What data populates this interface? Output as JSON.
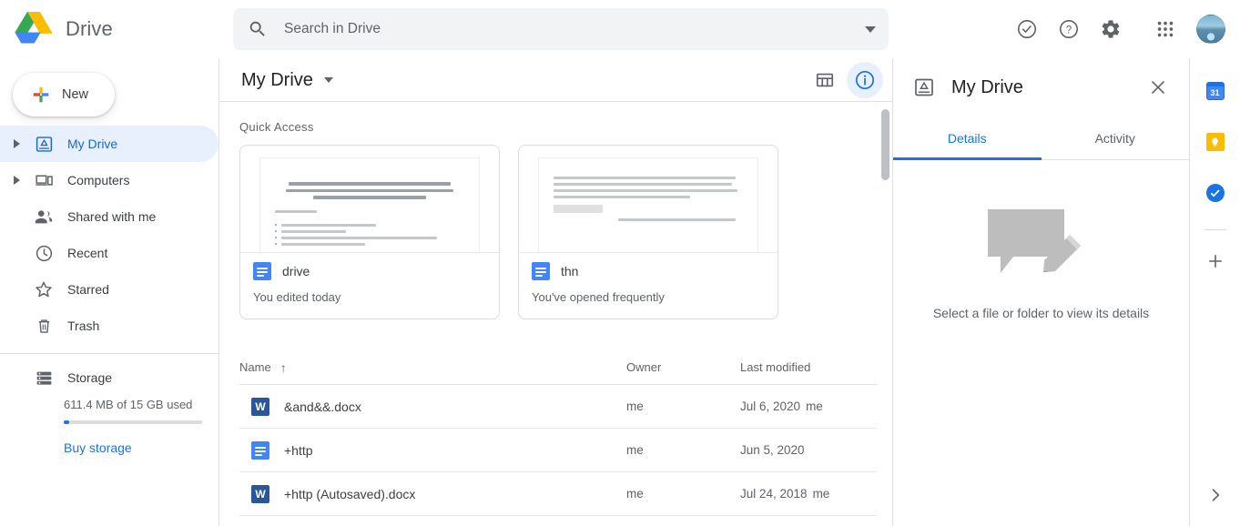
{
  "app": {
    "brand_title": "Drive",
    "logo_icon": "google-drive-logo"
  },
  "search": {
    "placeholder": "Search in Drive",
    "value": "",
    "icon": "search-icon",
    "options_icon": "caret-down-icon"
  },
  "topbar_actions": [
    {
      "name": "support-check-icon",
      "label": "Support"
    },
    {
      "name": "help-icon",
      "label": "Help"
    },
    {
      "name": "settings-gear-icon",
      "label": "Settings"
    },
    {
      "name": "apps-grid-icon",
      "label": "Google apps"
    },
    {
      "name": "avatar",
      "label": "Account"
    }
  ],
  "sidebar": {
    "new_button": {
      "label": "New",
      "icon": "plus-icon"
    },
    "items": [
      {
        "label": "My Drive",
        "icon": "my-drive-icon",
        "active": true,
        "expandable": true
      },
      {
        "label": "Computers",
        "icon": "computers-icon",
        "active": false,
        "expandable": true
      },
      {
        "label": "Shared with me",
        "icon": "shared-with-me-icon",
        "active": false,
        "expandable": false
      },
      {
        "label": "Recent",
        "icon": "clock-icon",
        "active": false,
        "expandable": false
      },
      {
        "label": "Starred",
        "icon": "star-icon",
        "active": false,
        "expandable": false
      },
      {
        "label": "Trash",
        "icon": "trash-icon",
        "active": false,
        "expandable": false
      }
    ],
    "storage": {
      "label": "Storage",
      "icon": "storage-icon",
      "usage_text": "611.4 MB of 15 GB used",
      "usage_percent": 4,
      "buy_label": "Buy storage"
    }
  },
  "main": {
    "breadcrumb": "My Drive",
    "breadcrumb_caret": "caret-down-icon",
    "view_toggle_icon": "grid-view-icon",
    "details_toggle_icon": "info-circle-icon",
    "quick_access": {
      "title": "Quick Access",
      "cards": [
        {
          "name": "drive",
          "subtitle": "You edited today",
          "icon": "google-docs-icon"
        },
        {
          "name": "thn",
          "subtitle": "You've opened frequently",
          "icon": "google-docs-icon"
        }
      ]
    },
    "table": {
      "columns": [
        "Name",
        "Owner",
        "Last modified"
      ],
      "sort_icon": "arrow-up-icon",
      "rows": [
        {
          "name": "&and&&.docx",
          "icon": "word-doc-icon",
          "owner": "me",
          "modified": "Jul 6, 2020",
          "modified_by": "me"
        },
        {
          "name": "+http",
          "icon": "google-docs-icon",
          "owner": "me",
          "modified": "Jun 5, 2020",
          "modified_by": ""
        },
        {
          "name": "+http (Autosaved).docx",
          "icon": "word-doc-icon",
          "owner": "me",
          "modified": "Jul 24, 2018",
          "modified_by": "me"
        }
      ]
    }
  },
  "details_panel": {
    "icon": "my-drive-icon",
    "title": "My Drive",
    "close_icon": "close-icon",
    "tabs": [
      {
        "label": "Details",
        "active": true
      },
      {
        "label": "Activity",
        "active": false
      }
    ],
    "empty_state": {
      "illustration": "comment-pencil-illustration",
      "text": "Select a file or folder to view its details"
    }
  },
  "right_rail": {
    "apps": [
      {
        "name": "google-calendar-icon",
        "label": "Calendar",
        "badge": "31"
      },
      {
        "name": "google-keep-icon",
        "label": "Keep",
        "badge": ""
      },
      {
        "name": "google-tasks-icon",
        "label": "Tasks",
        "badge": ""
      }
    ],
    "add_icon": "plus-icon",
    "expand_icon": "chevron-right-icon"
  },
  "colors": {
    "accent_blue": "#1a73e8",
    "active_nav_bg": "#e8f0fe",
    "text_primary": "#202124",
    "text_secondary": "#5f6368",
    "border": "#e0e0e0",
    "search_bg": "#f1f3f4",
    "keep_yellow": "#fbbc04"
  }
}
